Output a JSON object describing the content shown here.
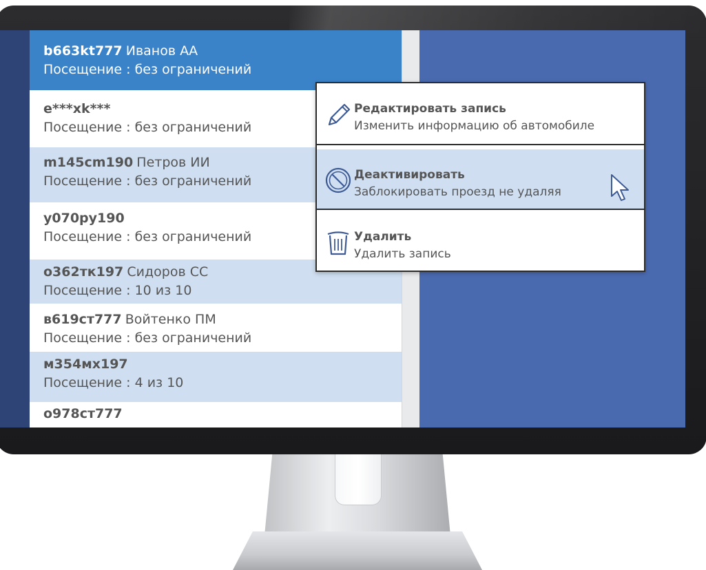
{
  "vehicles": [
    {
      "plate": "b663kt777",
      "owner": "Иванов АА",
      "visit": "Посещение : без ограничений"
    },
    {
      "plate": "e***xk***",
      "owner": "",
      "visit": "Посещение : без ограничений"
    },
    {
      "plate": "m145cm190",
      "owner": " Петров ИИ",
      "visit": "Посещение : без ограничений"
    },
    {
      "plate": "y070py190",
      "owner": "",
      "visit": "Посещение : без ограничений"
    },
    {
      "plate": "о362тк197",
      "owner": "Сидоров СС",
      "visit": "Посещение : 10 из 10"
    },
    {
      "plate": "в619ст777",
      "owner": "Войтенко ПМ",
      "visit": "Посещение : без ограничений"
    },
    {
      "plate": "м354мх197",
      "owner": "",
      "visit": "Посещение : 4 из 10"
    },
    {
      "plate": "о978ст777",
      "owner": "",
      "visit": ""
    }
  ],
  "context_menu": {
    "edit": {
      "title": "Редактировать запись",
      "desc": "Изменить информацию об автомобиле",
      "icon": "pencil-icon"
    },
    "deactivate": {
      "title": "Деактивировать",
      "desc": "Заблокировать проезд не удаляя",
      "icon": "block-icon"
    },
    "delete": {
      "title": "Удалить",
      "desc": "Удалить запись",
      "icon": "trash-icon"
    }
  },
  "colors": {
    "selected_row": "#3b83c8",
    "alt_row": "#cfdff1",
    "screen_bg": "#4a6ab0",
    "text": "#555555"
  }
}
